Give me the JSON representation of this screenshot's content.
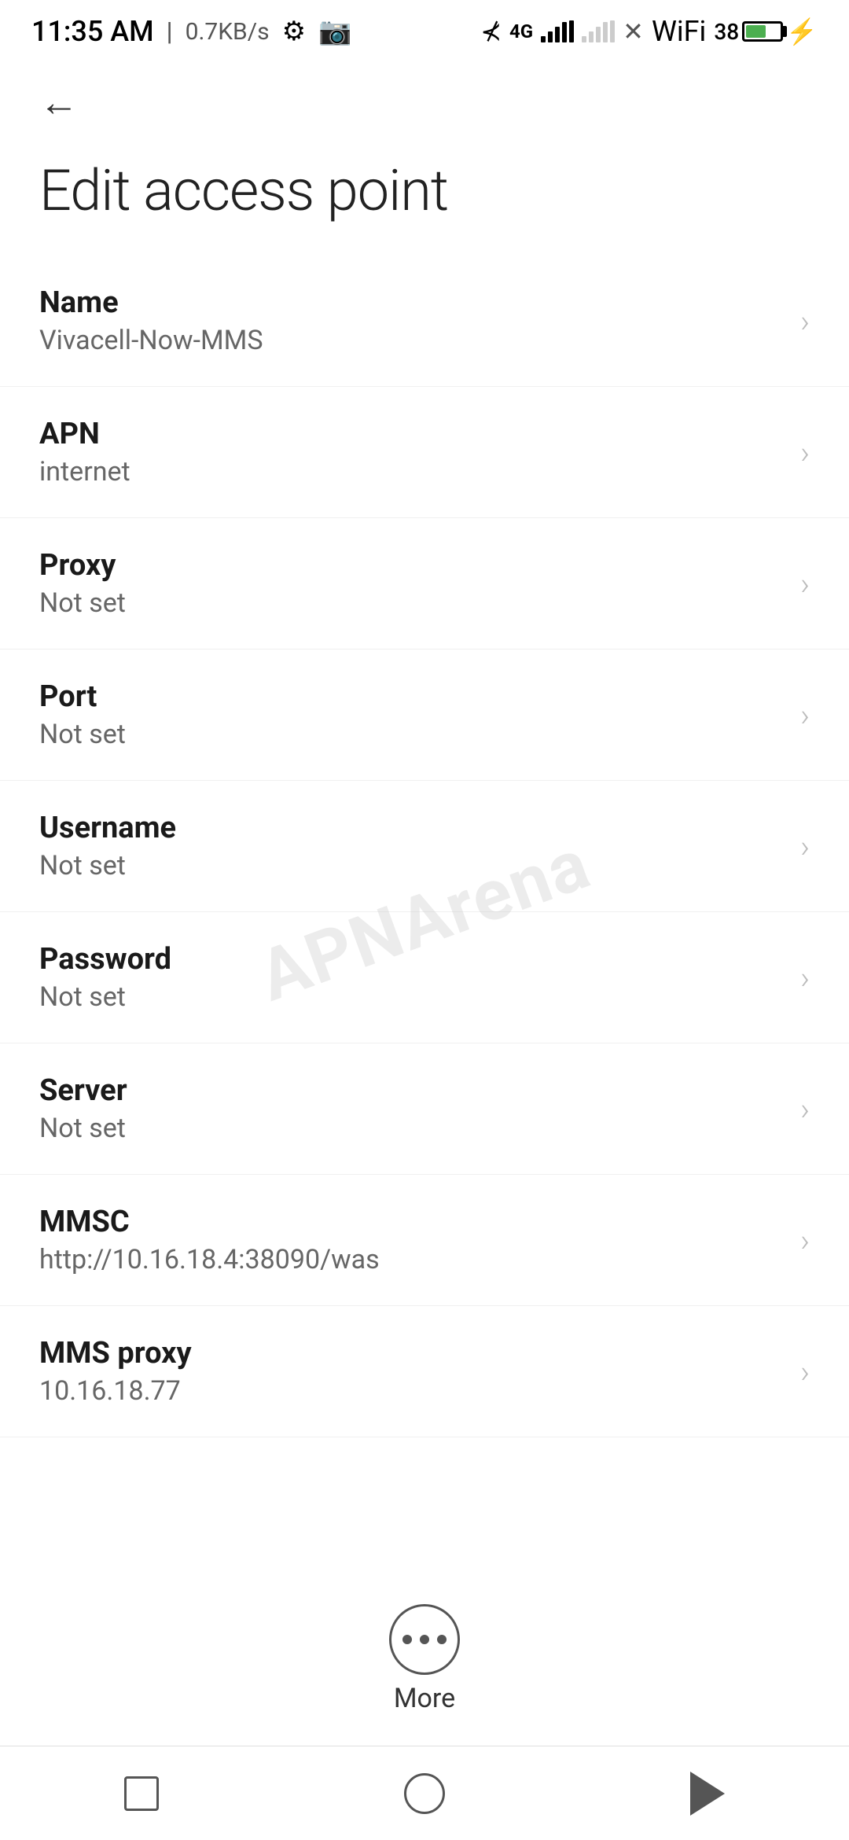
{
  "statusBar": {
    "time": "11:35 AM",
    "speed": "0.7KB/s"
  },
  "navigation": {
    "backLabel": "←"
  },
  "page": {
    "title": "Edit access point"
  },
  "settings": [
    {
      "id": "name",
      "label": "Name",
      "value": "Vivacell-Now-MMS"
    },
    {
      "id": "apn",
      "label": "APN",
      "value": "internet"
    },
    {
      "id": "proxy",
      "label": "Proxy",
      "value": "Not set"
    },
    {
      "id": "port",
      "label": "Port",
      "value": "Not set"
    },
    {
      "id": "username",
      "label": "Username",
      "value": "Not set"
    },
    {
      "id": "password",
      "label": "Password",
      "value": "Not set"
    },
    {
      "id": "server",
      "label": "Server",
      "value": "Not set"
    },
    {
      "id": "mmsc",
      "label": "MMSC",
      "value": "http://10.16.18.4:38090/was"
    },
    {
      "id": "mms-proxy",
      "label": "MMS proxy",
      "value": "10.16.18.77"
    }
  ],
  "more": {
    "label": "More"
  },
  "watermark": {
    "text": "APNArena"
  }
}
